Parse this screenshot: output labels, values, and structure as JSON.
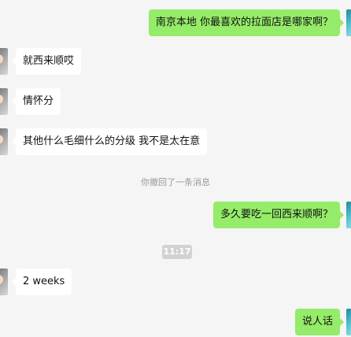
{
  "messages": [
    {
      "side": "out",
      "text": "南京本地 你最喜欢的拉面店是哪家啊？"
    },
    {
      "side": "in",
      "text": "就西来顺哎"
    },
    {
      "side": "in",
      "text": "情怀分"
    },
    {
      "side": "in",
      "text": "其他什么毛细什么的分级 我不是太在意"
    },
    {
      "side": "out",
      "text": "多久要吃一回西来顺啊？"
    },
    {
      "side": "in",
      "text": "2 weeks"
    },
    {
      "side": "out",
      "text": "说人话"
    }
  ],
  "system_notice": "你撤回了一条消息",
  "timestamp": "11:17"
}
